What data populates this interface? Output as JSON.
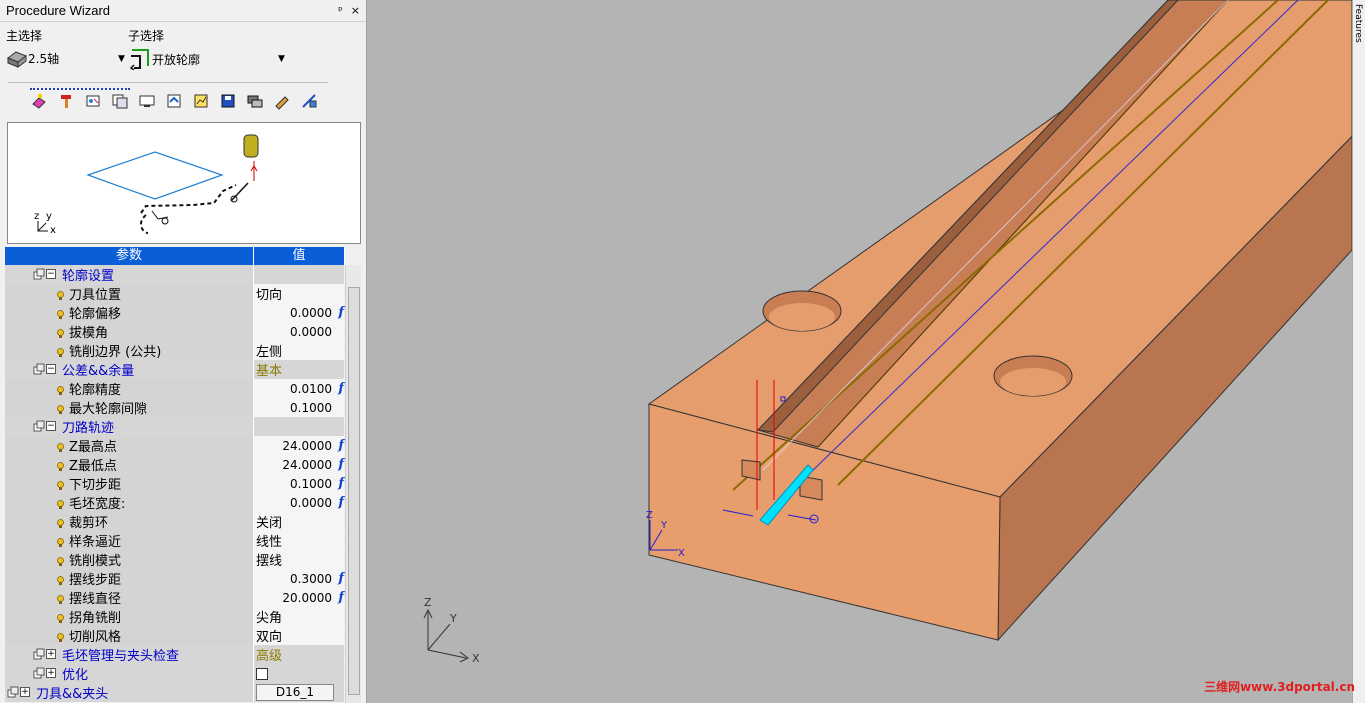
{
  "window": {
    "title": "Procedure Wizard",
    "pin": "ᵖ",
    "close": "×"
  },
  "selection": {
    "main_label": "主选择",
    "main_value": "2.5轴",
    "sub_label": "子选择",
    "sub_value": "开放轮廓"
  },
  "toolbar_icons": [
    "wizard-icon",
    "tool-icon",
    "view-params-icon",
    "copy-params-icon",
    "monitor-icon",
    "save-template-icon",
    "chart-icon",
    "disk-icon",
    "layers-icon",
    "edit-icon",
    "cut-icon"
  ],
  "preview": {
    "axis_z": "z",
    "axis_y": "y",
    "axis_x": "x"
  },
  "grid": {
    "col_param": "参数",
    "col_value": "值",
    "rows": [
      {
        "type": "grp",
        "label": "轮廓设置",
        "value": ""
      },
      {
        "type": "item",
        "label": "刀具位置",
        "value": "切向"
      },
      {
        "type": "item",
        "label": "轮廓偏移",
        "value": "0.0000",
        "f": true
      },
      {
        "type": "item",
        "label": "拔模角",
        "value": "0.0000"
      },
      {
        "type": "item",
        "label": "铣削边界 (公共)",
        "value": "左侧"
      },
      {
        "type": "grp",
        "label": "公差&&余量",
        "value": "基本",
        "valcolor": "#8a7a00"
      },
      {
        "type": "item",
        "label": "轮廓精度",
        "value": "0.0100",
        "f": true
      },
      {
        "type": "item",
        "label": "最大轮廓间隙",
        "value": "0.1000"
      },
      {
        "type": "grp",
        "label": "刀路轨迹",
        "value": ""
      },
      {
        "type": "item",
        "label": "Z最高点",
        "value": "24.0000",
        "f": true
      },
      {
        "type": "item",
        "label": "Z最低点",
        "value": "24.0000",
        "f": true
      },
      {
        "type": "item",
        "label": "下切步距",
        "value": "0.1000",
        "f": true
      },
      {
        "type": "item",
        "label": "毛坯宽度:",
        "value": "0.0000",
        "f": true
      },
      {
        "type": "item",
        "label": "裁剪环",
        "value": "关闭"
      },
      {
        "type": "item",
        "label": "样条逼近",
        "value": "线性"
      },
      {
        "type": "item",
        "label": "铣削模式",
        "value": "摆线"
      },
      {
        "type": "item",
        "label": "摆线步距",
        "value": "0.3000",
        "f": true
      },
      {
        "type": "item",
        "label": "摆线直径",
        "value": "20.0000",
        "f": true
      },
      {
        "type": "item",
        "label": "拐角铣削",
        "value": "尖角"
      },
      {
        "type": "item",
        "label": "切削风格",
        "value": "双向"
      },
      {
        "type": "grp2",
        "label": "毛坯管理与夹头检查",
        "value": "高级",
        "valcolor": "#8a7a00"
      },
      {
        "type": "grp2",
        "label": "优化",
        "value": "",
        "checkbox": true
      },
      {
        "type": "grp3",
        "label": "刀具&&夹头",
        "value": "D16_1",
        "button": true
      }
    ]
  },
  "viewport": {
    "axis_z": "Z",
    "axis_y": "Y",
    "axis_x": "X"
  },
  "side_tab": "Features",
  "watermark": "三维网www.3dportal.cn"
}
